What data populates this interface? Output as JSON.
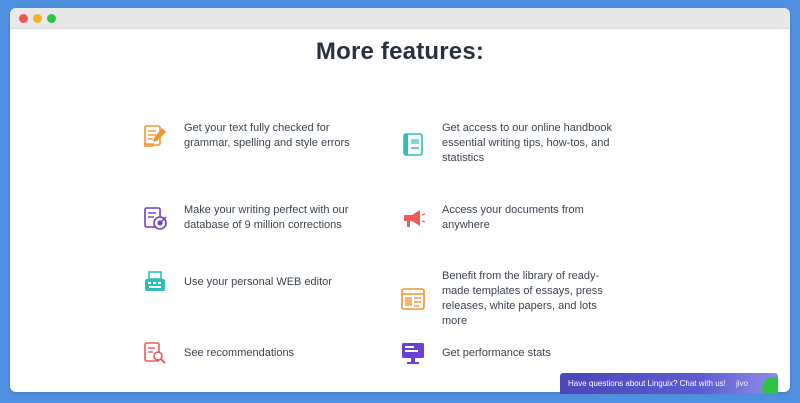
{
  "window": {
    "controls": [
      "close",
      "minimize",
      "maximize"
    ]
  },
  "title": "More features:",
  "features": [
    {
      "text": "Get your text fully checked for grammar, spelling and style errors",
      "icon": "edit-document-icon",
      "color": "#f2952c"
    },
    {
      "text": "Get access to our online handbook essential writing tips, how-tos, and statistics",
      "icon": "book-icon",
      "color": "#2fbfb8"
    },
    {
      "text": "Make your writing perfect with our database of 9 million corrections",
      "icon": "target-document-icon",
      "color": "#6a3fd1"
    },
    {
      "text": "Access your documents from anywhere",
      "icon": "megaphone-icon",
      "color": "#ef5a5a"
    },
    {
      "text": "Use your personal WEB editor",
      "icon": "typewriter-icon",
      "color": "#2fbfb8"
    },
    {
      "text": "Benefit from the library of ready-made templates of essays, press releases, white papers, and lots more",
      "icon": "template-window-icon",
      "color": "#f2952c"
    },
    {
      "text": "See recommendations",
      "icon": "document-search-icon",
      "color": "#ef5a5a"
    },
    {
      "text": "Get performance stats",
      "icon": "monitor-icon",
      "color": "#6a3fd1"
    }
  ],
  "chat": {
    "label": "Have questions about Linguix? Chat with us!",
    "brand": "jivo"
  }
}
